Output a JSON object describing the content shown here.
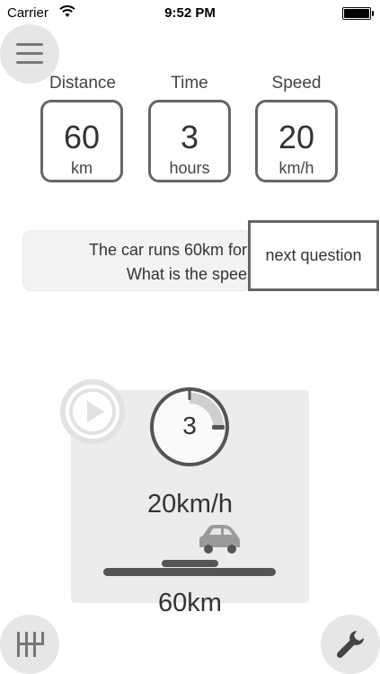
{
  "status_bar": {
    "carrier": "Carrier",
    "time": "9:52 PM"
  },
  "icons": {
    "menu": "hamburger-menu-icon",
    "play": "play-icon",
    "timer": "timer-icon",
    "car": "car-icon",
    "gear": "gear-shift-icon",
    "wrench": "wrench-icon"
  },
  "metrics": [
    {
      "label": "Distance",
      "value": "60",
      "unit": "km"
    },
    {
      "label": "Time",
      "value": "3",
      "unit": "hours"
    },
    {
      "label": "Speed",
      "value": "20",
      "unit": "km/h"
    }
  ],
  "question": {
    "line1": "The car runs 60km for",
    "line2": "What is the spee",
    "next_label": "next question"
  },
  "simulation": {
    "timer_value": "3",
    "speed_label": "20km/h",
    "distance_label": "60km"
  },
  "colors": {
    "panel_bg": "#ececec",
    "card_border": "#666666",
    "button_bg": "#e6e6e6"
  }
}
